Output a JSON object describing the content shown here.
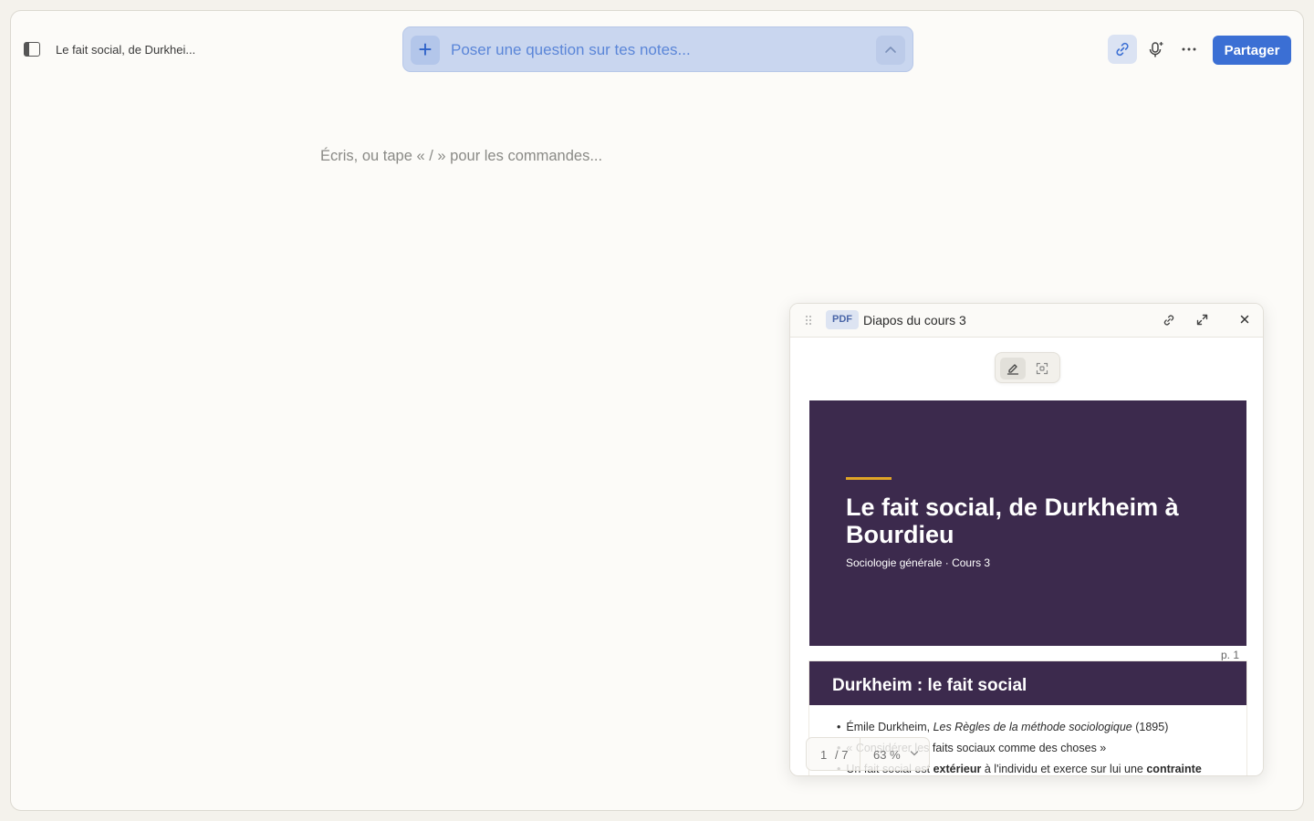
{
  "header": {
    "doc_title": "Le fait social, de Durkhei...",
    "ask_placeholder": "Poser une question sur tes notes...",
    "ask_plus_label": "+",
    "share_label": "Partager"
  },
  "editor": {
    "placeholder": "Écris, ou tape « / » pour les commandes..."
  },
  "pdf_viewer": {
    "badge": "PDF",
    "title": "Diapos du cours 3",
    "slide1": {
      "title": "Le fait social, de Durkheim à Bourdieu",
      "subtitle": "Sociologie générale · Cours 3"
    },
    "page_label": "p. 1",
    "slide2": {
      "title": "Durkheim : le fait social",
      "bullets": [
        "Émile Durkheim, Les Règles de la méthode sociologique (1895)",
        "« Considérer les faits sociaux comme des choses »",
        "Un fait social est extérieur à l'individu et exerce sur lui une contrainte"
      ]
    },
    "pager": {
      "current_page": "1",
      "total": "/ 7",
      "zoom": "63 %"
    }
  },
  "icons": {
    "sidebar_toggle": "sidebar-toggle-icon",
    "link": "link-icon",
    "mic": "microphone-sparkle-icon",
    "more": "more-horizontal-icon",
    "chevron_up": "chevron-up-icon",
    "drag": "drag-handle-icon",
    "expand": "expand-icon",
    "close": "close-icon",
    "annotate": "highlighter-icon",
    "select_area": "select-area-icon"
  },
  "colors": {
    "accent": "#3b6fd4",
    "ask_bar_bg": "#c9d6ef",
    "slide_bg": "#3c2a4d",
    "slide_rule": "#e0a526"
  }
}
